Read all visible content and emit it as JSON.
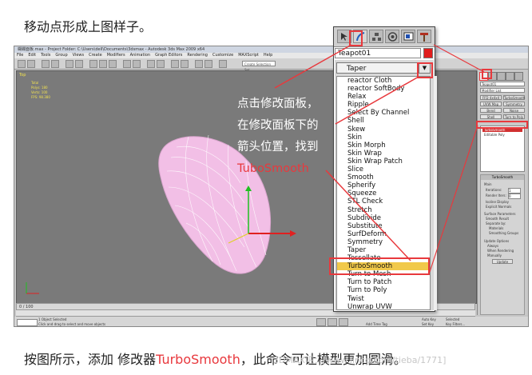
{
  "captions": {
    "top": "移动点形成上图样子。",
    "bottom_before": "按图所示，添加 修改器",
    "bottom_highlight": "TurboSmooth",
    "bottom_after": "，此命令可让模型更加圆滑。"
  },
  "watermark": "3DMAX吧：[www.lincg.com/tieba/1771]",
  "app": {
    "title": "蝴蝶面板.max  - Project Folder: C:\\Users\\dell\\Documents\\3dsmax  - Autodesk 3ds Max 2009 x64",
    "menus": [
      "File",
      "Edit",
      "Tools",
      "Group",
      "Views",
      "Create",
      "Modifiers",
      "Animation",
      "Graph Editors",
      "Rendering",
      "Customize",
      "MAXScript",
      "Help"
    ],
    "selection_set": "Create Selection Set",
    "viewport_label": "Top",
    "viewport_stats": [
      "Total",
      "Polys: 180",
      "Verts: 100",
      "FPS: 98.380"
    ],
    "timebar": "0 / 100",
    "status_line1": "1 Object Selected",
    "status_line2": "Click and drag to select and move objects",
    "status_welcome": "Auto Key",
    "status_setkey": "Set Key",
    "status_selected": "Selected",
    "status_keyfilters": "Key Filters...",
    "status_addtime": "Add Time Tag"
  },
  "command_panel": {
    "object_name": "Teapot01",
    "modifier_list": "Modifier List",
    "buttons": [
      "FFD 4x4x4",
      "TurboSmooth",
      "UVW Map",
      "Symmetry",
      "Bend",
      "Noise",
      "Shell",
      "Turn to Poly"
    ],
    "stack": [
      "TurboSmooth",
      "Editable Poly"
    ],
    "rollout_title": "TurboSmooth",
    "main_label": "Main",
    "iterations_label": "Iterations:",
    "iterations_value": "1",
    "render_iters_label": "Render Iters:",
    "render_iters_value": "0",
    "isoline_display": "Isoline Display",
    "explicit_normals": "Explicit Normals",
    "surface_params": "Surface Parameters",
    "smooth_result": "Smooth Result",
    "separate_by": "Separate by:",
    "materials": "Materials",
    "smoothing_groups": "Smoothing Groups",
    "update_options": "Update Options",
    "always": "Always",
    "when_rendering": "When Rendering",
    "manually": "Manually",
    "update_btn": "Update"
  },
  "dropdown": {
    "object_name": "Teapot01",
    "selected_modifier": "Taper",
    "items": [
      "reactor Cloth",
      "reactor SoftBody",
      "Relax",
      "Ripple",
      "Select By Channel",
      "Shell",
      "Skew",
      "Skin",
      "Skin Morph",
      "Skin Wrap",
      "Skin Wrap Patch",
      "Slice",
      "Smooth",
      "Spherify",
      "Squeeze",
      "STL Check",
      "Stretch",
      "Subdivide",
      "Substitute",
      "SurfDeform",
      "Symmetry",
      "Taper",
      "Tessellate",
      "TurboSmooth",
      "Turn to Mesh",
      "Turn to Patch",
      "Turn to Poly",
      "Twist",
      "Unwrap UVW"
    ],
    "highlighted_item": "TurboSmooth"
  },
  "annotation": {
    "line1": "点击修改面板，",
    "line2": "在修改面板下的",
    "line3": "箭头位置，找到",
    "line4": "TuboSmooth"
  },
  "colors": {
    "accent_red": "#e8393d",
    "highlight_yellow": "#f1c94a",
    "mesh_pink": "#f2bfe6",
    "viewport_gray": "#7a7a7a"
  }
}
